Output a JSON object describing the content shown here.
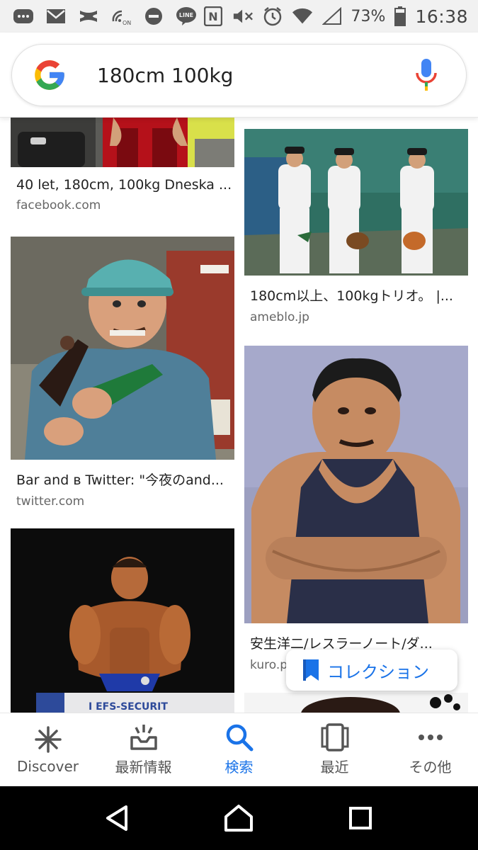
{
  "status_bar": {
    "battery": "73%",
    "time": "16:38",
    "line_badge": "LINE",
    "nfc_label": "N",
    "on_label": "ON"
  },
  "search": {
    "query": "180cm 100kg"
  },
  "results": [
    {
      "title": "40 let, 180cm, 100kg Dneska ...",
      "source": "facebook.com"
    },
    {
      "title": "180cm以上、100kgトリオ。 |...",
      "source": "ameblo.jp"
    },
    {
      "title": "Bar and в Twitter: \"今夜のand...",
      "source": "twitter.com"
    },
    {
      "title": "安生洋二/レスラーノート/ダ...",
      "source": "kuro.p"
    }
  ],
  "image_texts": {
    "bodybuilder_banner": "I EFS-SECURIT"
  },
  "collection_button": {
    "label": "コレクション"
  },
  "bottom_nav": [
    {
      "label": "Discover",
      "icon": "asterisk-icon"
    },
    {
      "label": "最新情報",
      "icon": "inbox-icon"
    },
    {
      "label": "検索",
      "icon": "search-icon",
      "active": true
    },
    {
      "label": "最近",
      "icon": "recent-cards-icon"
    },
    {
      "label": "その他",
      "icon": "more-dots-icon"
    }
  ],
  "colors": {
    "accent": "#1a73e8",
    "google_blue": "#4285F4",
    "google_red": "#EA4335",
    "google_yellow": "#FBBC05",
    "google_green": "#34A853"
  }
}
